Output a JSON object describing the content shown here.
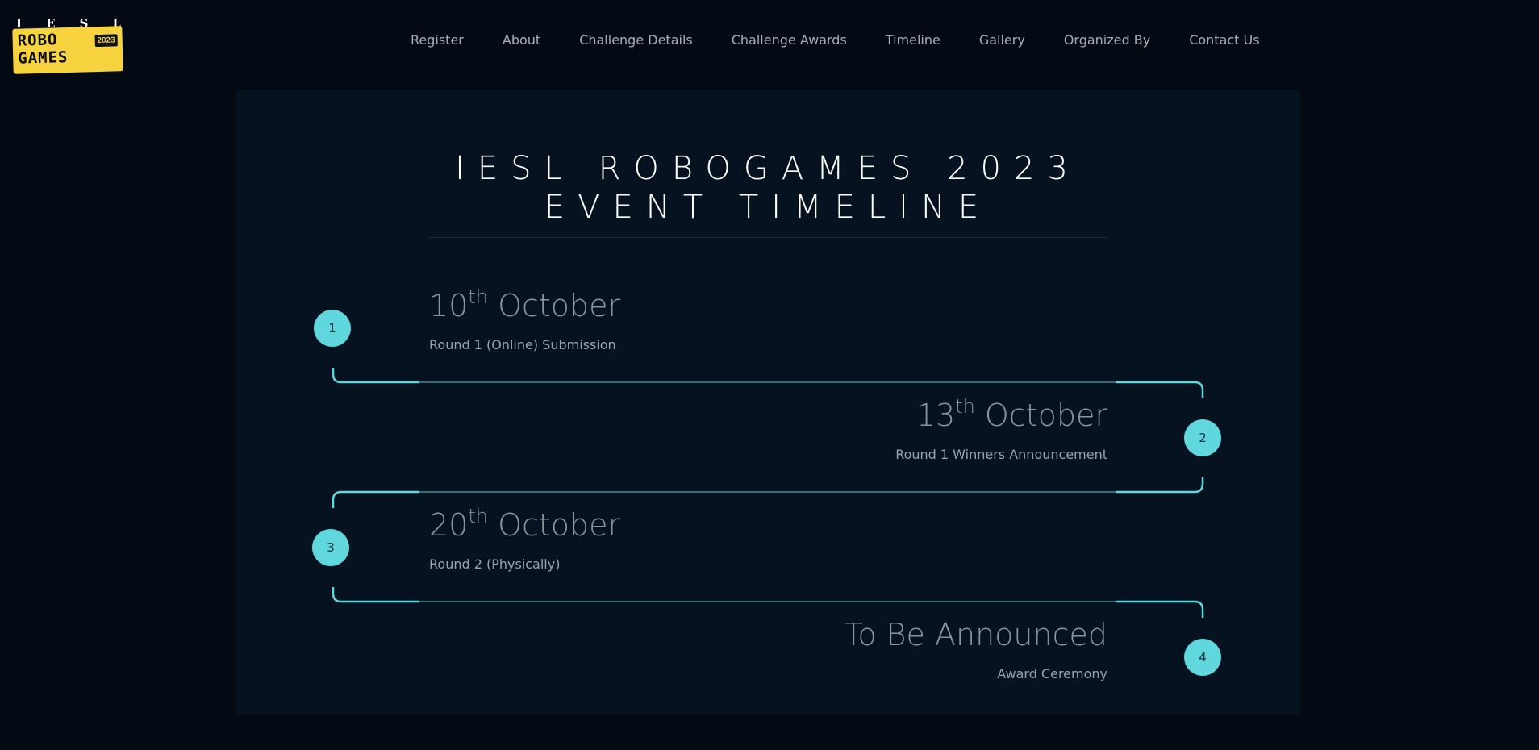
{
  "logo": {
    "letters": [
      "I",
      "E",
      "S",
      "L"
    ],
    "word_line1": "ROBO",
    "word_line2": "GAMES",
    "year": "2023",
    "brand_color": "#f6d33f"
  },
  "nav": {
    "items": [
      {
        "label": "Register"
      },
      {
        "label": "About"
      },
      {
        "label": "Challenge Details"
      },
      {
        "label": "Challenge Awards"
      },
      {
        "label": "Timeline"
      },
      {
        "label": "Gallery"
      },
      {
        "label": "Organized By"
      },
      {
        "label": "Contact Us"
      }
    ]
  },
  "page": {
    "title_line1": "IESL ROBOGAMES 2023",
    "title_line2": "EVENT TIMELINE"
  },
  "timeline": {
    "accent_color": "#5fd7dc",
    "events": [
      {
        "number": "1",
        "day": "10",
        "suffix": "th",
        "month": "October",
        "description": "Round 1 (Online) Submission",
        "side": "left"
      },
      {
        "number": "2",
        "day": "13",
        "suffix": "th",
        "month": "October",
        "description": "Round 1 Winners Announcement",
        "side": "right"
      },
      {
        "number": "3",
        "day": "20",
        "suffix": "th",
        "month": "October",
        "description": "Round 2 (Physically)",
        "side": "left"
      },
      {
        "number": "4",
        "date_text": "To Be Announced",
        "description": "Award Ceremony",
        "side": "right"
      }
    ]
  }
}
